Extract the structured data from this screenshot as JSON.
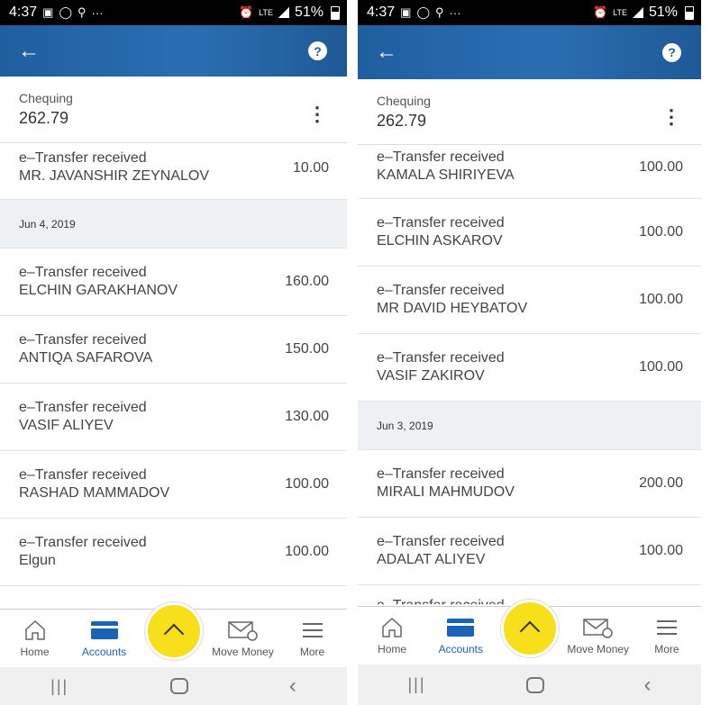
{
  "status": {
    "time": "4:37",
    "battery": "51%",
    "lte": "LTE"
  },
  "account": {
    "name": "Chequing",
    "balance": "262.79"
  },
  "nav": {
    "home": "Home",
    "accounts": "Accounts",
    "move_money": "Move Money",
    "more": "More"
  },
  "left": {
    "first_row": {
      "type": "e–Transfer received",
      "name": "MR. JAVANSHIR ZEYNALOV",
      "amount": "10.00"
    },
    "date": "Jun 4, 2019",
    "rows": [
      {
        "type": "e–Transfer received",
        "name": "ELCHIN  GARAKHANOV",
        "amount": "160.00"
      },
      {
        "type": "e–Transfer received",
        "name": "ANTIQA SAFAROVA",
        "amount": "150.00"
      },
      {
        "type": "e–Transfer received",
        "name": "VASIF ALIYEV",
        "amount": "130.00"
      },
      {
        "type": "e–Transfer received",
        "name": "RASHAD MAMMADOV",
        "amount": "100.00"
      },
      {
        "type": "e–Transfer received",
        "name": "Elgun",
        "amount": "100.00"
      }
    ]
  },
  "right": {
    "rows_top": [
      {
        "type": "e–Transfer received",
        "name": "KAMALA SHIRIYEVA",
        "amount": "100.00"
      },
      {
        "type": "e–Transfer received",
        "name": "ELCHIN ASKAROV",
        "amount": "100.00"
      },
      {
        "type": "e–Transfer received",
        "name": "MR DAVID HEYBATOV",
        "amount": "100.00"
      },
      {
        "type": "e–Transfer received",
        "name": "VASIF ZAKIROV",
        "amount": "100.00"
      }
    ],
    "date": "Jun 3, 2019",
    "rows_bottom": [
      {
        "type": "e–Transfer received",
        "name": "MIRALI MAHMUDOV",
        "amount": "200.00"
      },
      {
        "type": "e–Transfer received",
        "name": "ADALAT ALIYEV",
        "amount": "100.00"
      }
    ],
    "partial": "e–Transfer received"
  }
}
